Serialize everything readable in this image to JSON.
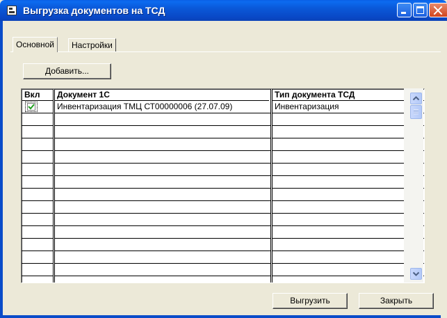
{
  "window": {
    "title": "Выгрузка документов на ТСД"
  },
  "tabs": [
    {
      "label": "Основной",
      "active": true
    },
    {
      "label": "Настройки",
      "active": false
    }
  ],
  "toolbar": {
    "add_label": "Добавить..."
  },
  "table": {
    "columns": [
      "Вкл",
      "Документ 1С",
      "Тип документа ТСД"
    ],
    "rows": [
      {
        "enabled": true,
        "document": "Инвентаризация ТМЦ СТ00000006 (27.07.09)",
        "type": "Инвентаризация"
      }
    ]
  },
  "footer": {
    "export_label": "Выгрузить",
    "close_label": "Закрыть"
  },
  "colors": {
    "titlebar": "#0A58D8",
    "window_bg": "#ECE9D8",
    "close_button": "#D0451E"
  }
}
